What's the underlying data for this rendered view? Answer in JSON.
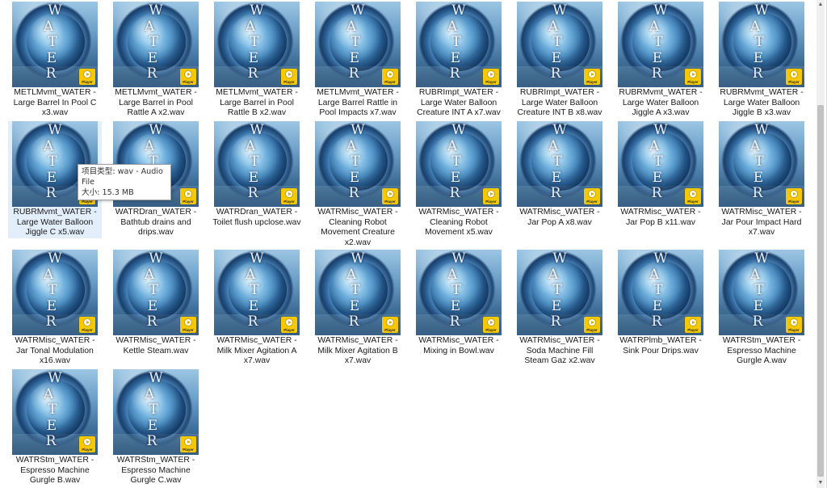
{
  "thumbnail": {
    "letters": [
      "W",
      "A",
      "T",
      "E",
      "R"
    ],
    "player_label": "Player"
  },
  "files": [
    {
      "name": "METLMvmt_WATER - Large Barrel In Pool C x3.wav"
    },
    {
      "name": "METLMvmt_WATER - Large Barrel in Pool Rattle A x2.wav"
    },
    {
      "name": "METLMvmt_WATER - Large Barrel in Pool Rattle B x2.wav"
    },
    {
      "name": "METLMvmt_WATER - Large Barrel Rattle in Pool Impacts x7.wav"
    },
    {
      "name": "RUBRImpt_WATER - Large Water Balloon Creature INT A x7.wav"
    },
    {
      "name": "RUBRImpt_WATER - Large Water Balloon Creature INT B x8.wav"
    },
    {
      "name": "RUBRMvmt_WATER - Large Water Balloon Jiggle A x3.wav"
    },
    {
      "name": "RUBRMvmt_WATER - Large Water Balloon Jiggle B x3.wav"
    },
    {
      "name": "RUBRMvmt_WATER - Large Water Balloon Jiggle C x5.wav",
      "selected": true
    },
    {
      "name": "WATRDran_WATER - Bathtub drains and drips.wav"
    },
    {
      "name": "WATRDran_WATER - Toilet flush upclose.wav"
    },
    {
      "name": "WATRMisc_WATER - Cleaning Robot Movement Creature x2.wav"
    },
    {
      "name": "WATRMisc_WATER - Cleaning Robot Movement x5.wav"
    },
    {
      "name": "WATRMisc_WATER - Jar Pop A x8.wav"
    },
    {
      "name": "WATRMisc_WATER - Jar Pop B x11.wav"
    },
    {
      "name": "WATRMisc_WATER - Jar Pour Impact Hard x7.wav"
    },
    {
      "name": "WATRMisc_WATER - Jar Tonal Modulation x16.wav"
    },
    {
      "name": "WATRMisc_WATER - Kettle Steam.wav"
    },
    {
      "name": "WATRMisc_WATER - Milk Mixer Agitation A x7.wav"
    },
    {
      "name": "WATRMisc_WATER - Milk Mixer Agitation B x7.wav"
    },
    {
      "name": "WATRMisc_WATER - Mixing in Bowl.wav"
    },
    {
      "name": "WATRMisc_WATER - Soda Machine Fill Steam Gaz x2.wav"
    },
    {
      "name": "WATRPlmb_WATER - Sink Pour Drips.wav"
    },
    {
      "name": "WATRStm_WATER - Espresso Machine Gurgle A.wav"
    },
    {
      "name": "WATRStm_WATER - Espresso Machine Gurgle B.wav"
    },
    {
      "name": "WATRStm_WATER - Espresso Machine Gurgle C.wav"
    }
  ],
  "tooltip": {
    "line1": "项目类型: wav - Audio File",
    "line2": "大小: 15.3 MB"
  },
  "scrollbar": {
    "up_glyph": "▲",
    "down_glyph": "▼"
  }
}
